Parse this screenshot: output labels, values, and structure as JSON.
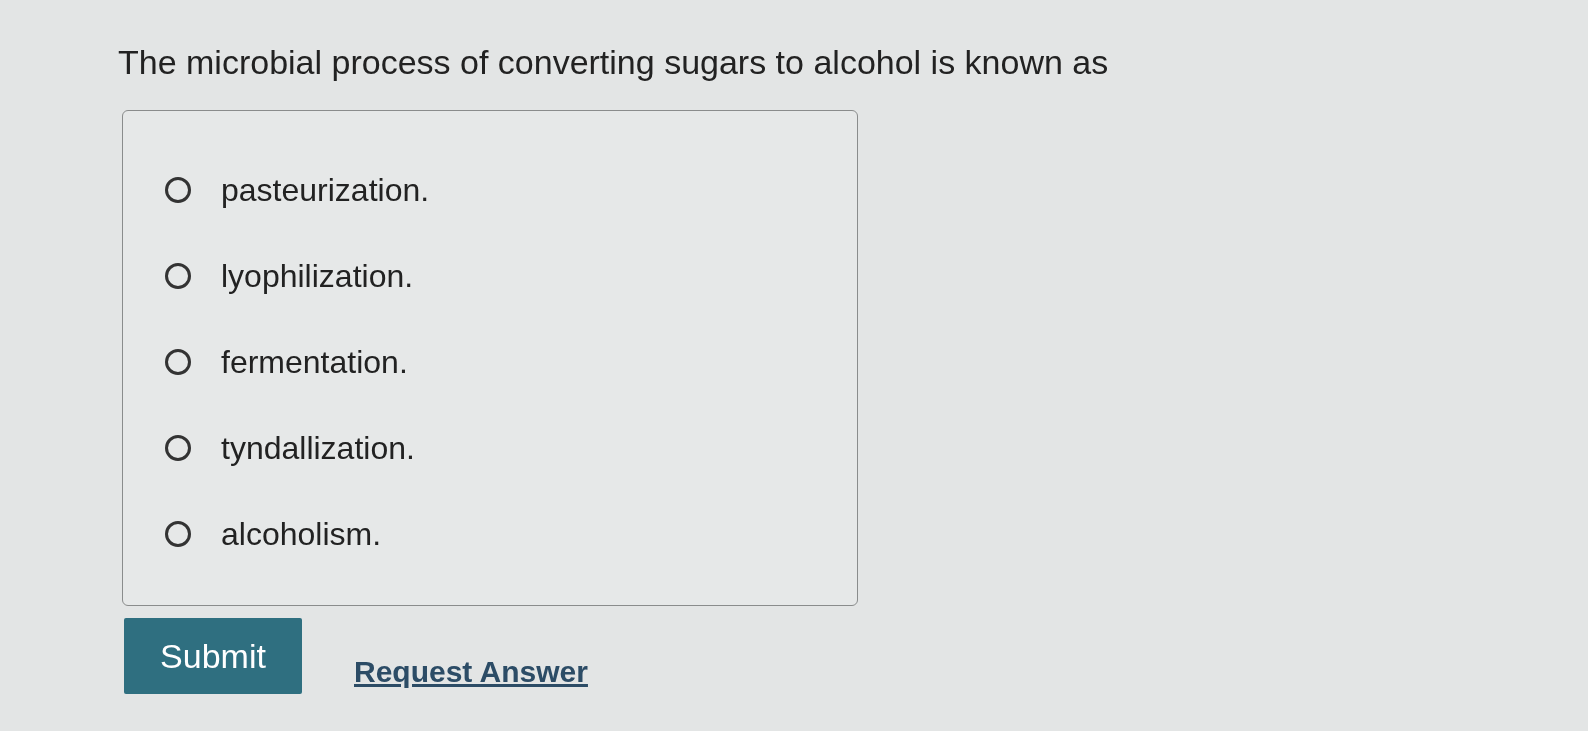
{
  "question": "The microbial process of converting sugars to alcohol is known as",
  "options": [
    {
      "label": "pasteurization.",
      "selected": false
    },
    {
      "label": "lyophilization.",
      "selected": false
    },
    {
      "label": "fermentation.",
      "selected": false
    },
    {
      "label": "tyndallization.",
      "selected": false
    },
    {
      "label": "alcoholism.",
      "selected": false
    }
  ],
  "submit_button": "Submit",
  "request_answer_link": "Request Answer"
}
